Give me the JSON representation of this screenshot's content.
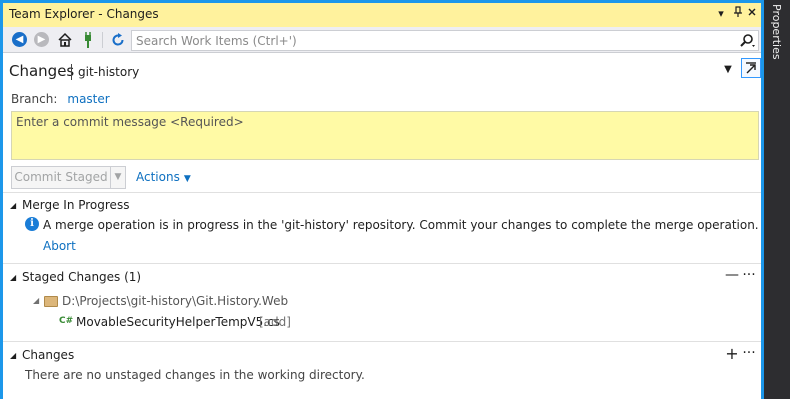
{
  "window": {
    "title": "Team Explorer - Changes",
    "pin_icon": "pin-icon",
    "close_icon": "close-icon",
    "dropdown_icon": "dropdown-arrow-icon"
  },
  "right_rail": {
    "label": "Properties"
  },
  "toolbar": {
    "search_placeholder": "Search Work Items (Ctrl+')"
  },
  "header": {
    "title": "Changes",
    "subtitle": "git-history"
  },
  "branch": {
    "label": "Branch:",
    "name": "master"
  },
  "commit": {
    "placeholder": "Enter a commit message <Required>",
    "button_label": "Commit Staged",
    "actions_label": "Actions"
  },
  "merge": {
    "title": "Merge In Progress",
    "message": "A merge operation is in progress in the 'git-history' repository. Commit your changes to complete the merge operation.",
    "abort_label": "Abort"
  },
  "staged": {
    "title": "Staged Changes (1)",
    "folder_path": "D:\\Projects\\git-history\\Git.History.Web",
    "files": [
      {
        "icon": "C#",
        "name": "MovableSecurityHelperTempV5.cs",
        "status": "[add]"
      }
    ]
  },
  "changes": {
    "title": "Changes",
    "empty_message": "There are no unstaged changes in the working directory."
  },
  "colors": {
    "accent": "#1c97ea",
    "title_bar": "#fff29d",
    "commit_box": "#fffaa5",
    "link": "#0e70c0"
  }
}
